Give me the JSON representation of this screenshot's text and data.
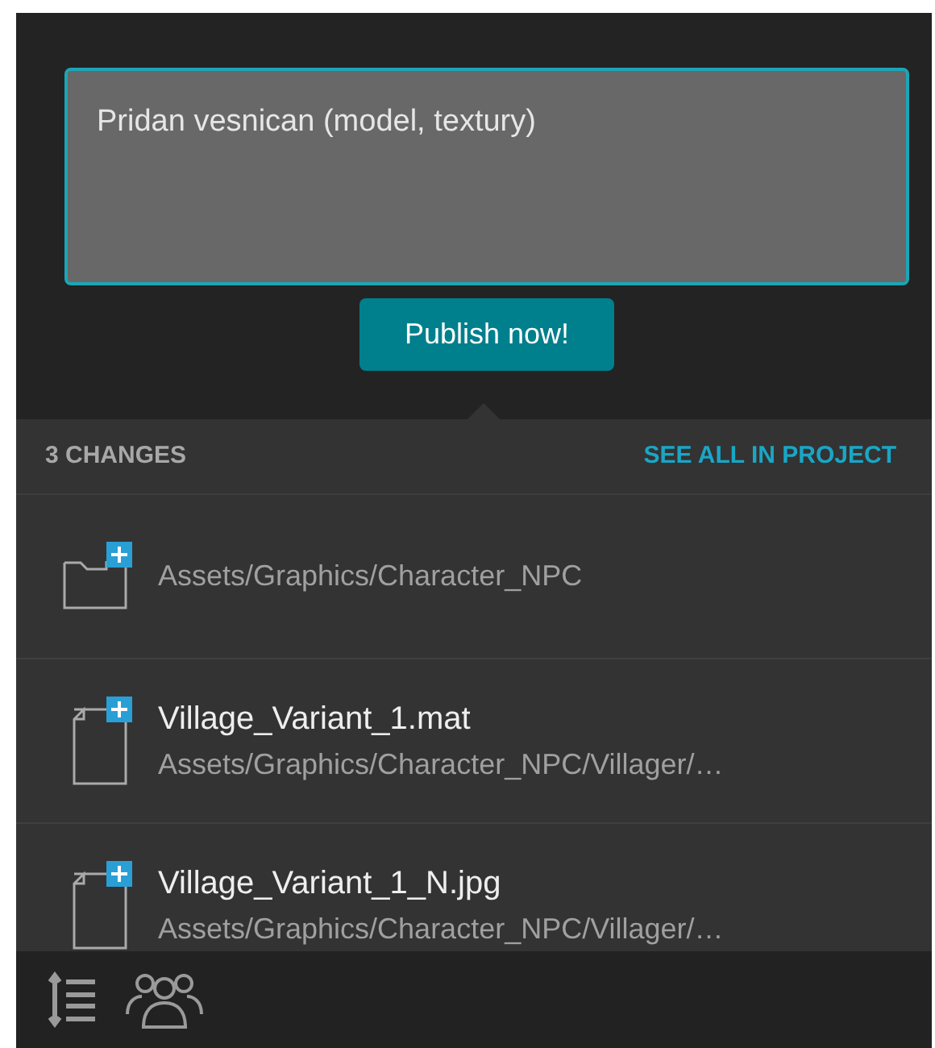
{
  "message": {
    "value": "Pridan vesnican (model, textury)"
  },
  "publish_button": "Publish now!",
  "changes_header": {
    "count": "3 CHANGES",
    "link": "SEE ALL IN PROJECT"
  },
  "changes": [
    {
      "kind": "folder",
      "path": "Assets/Graphics/Character_NPC"
    },
    {
      "kind": "file",
      "name": "Village_Variant_1.mat",
      "path": "Assets/Graphics/Character_NPC/Villager/…"
    },
    {
      "kind": "file",
      "name": "Village_Variant_1_N.jpg",
      "path": "Assets/Graphics/Character_NPC/Villager/…"
    }
  ]
}
